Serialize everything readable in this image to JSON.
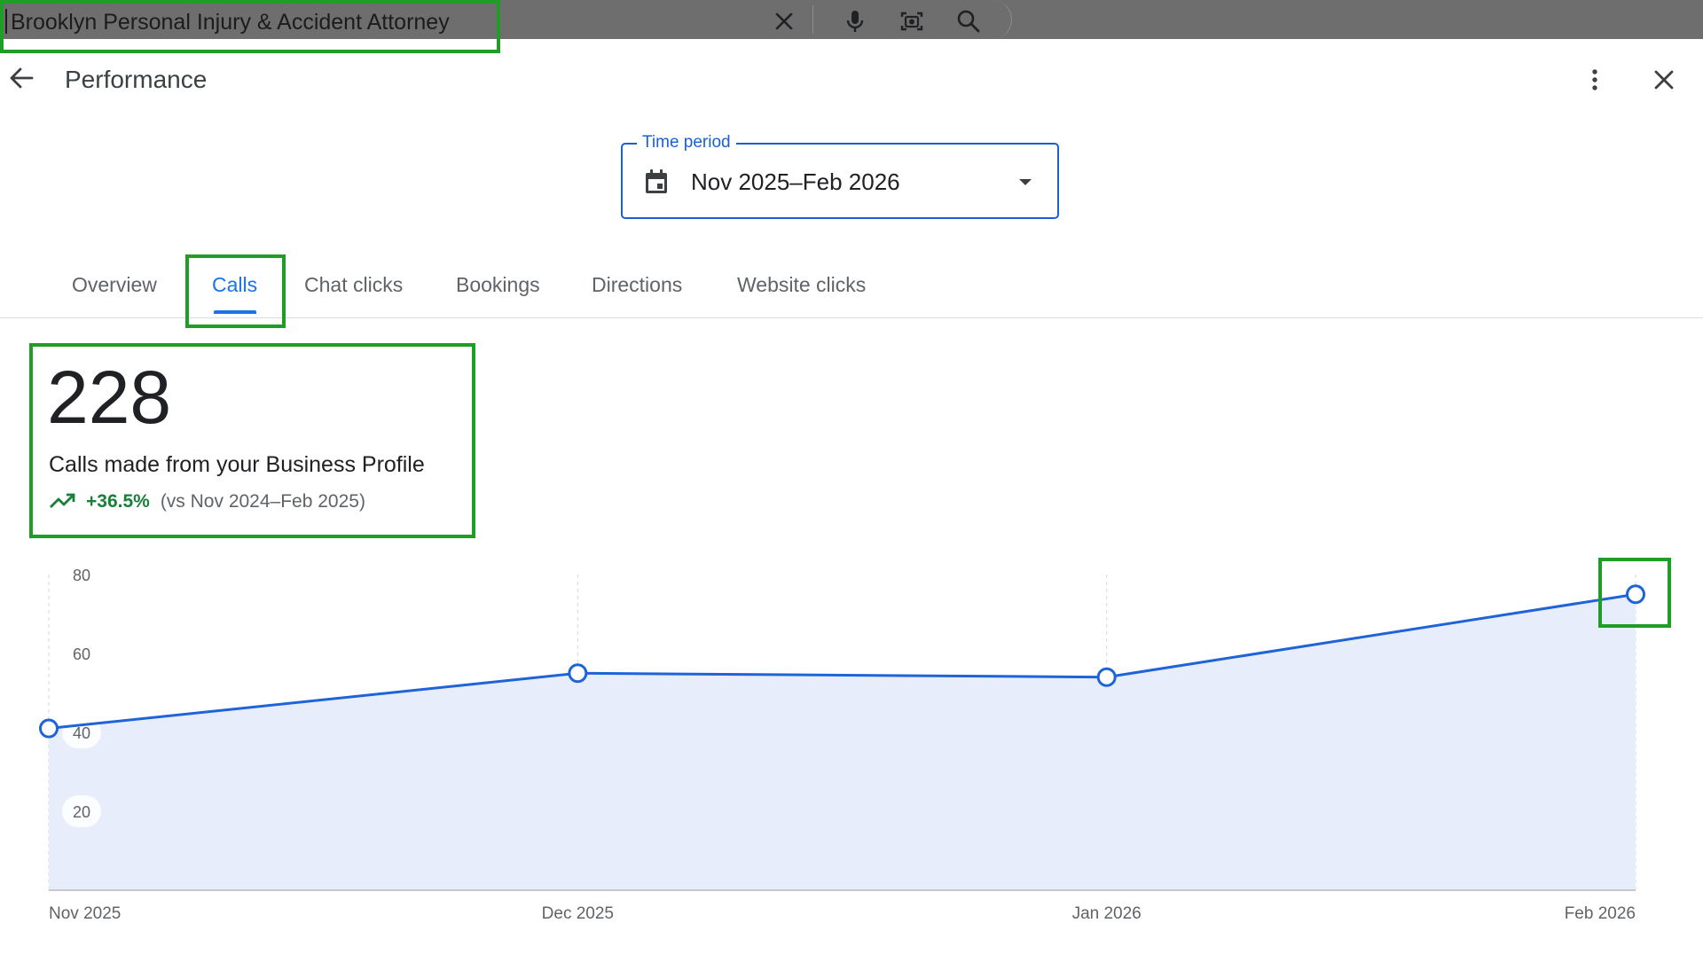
{
  "search": {
    "query": "Brooklyn Personal Injury & Accident Attorney",
    "icons": [
      "close-icon",
      "mic-icon",
      "camera-icon",
      "search-icon"
    ]
  },
  "header": {
    "title": "Performance",
    "icons": [
      "back-arrow-icon",
      "more-vert-icon",
      "close-icon"
    ]
  },
  "time_period": {
    "label": "Time period",
    "value": "Nov 2025–Feb 2026",
    "icon": "calendar-icon"
  },
  "tabs": [
    {
      "label": "Overview",
      "active": false
    },
    {
      "label": "Calls",
      "active": true
    },
    {
      "label": "Chat clicks",
      "active": false
    },
    {
      "label": "Bookings",
      "active": false
    },
    {
      "label": "Directions",
      "active": false
    },
    {
      "label": "Website clicks",
      "active": false
    }
  ],
  "summary": {
    "value": "228",
    "description": "Calls made from your Business Profile",
    "change": "+36.5%",
    "comparison": "(vs Nov 2024–Feb 2025)"
  },
  "colors": {
    "accent": "#1a73e8",
    "line": "#1e63d8",
    "area": "#e8edfb",
    "positive": "#188038",
    "highlight": "#1e9e26"
  },
  "chart_data": {
    "type": "area",
    "x": [
      "Nov 2025",
      "Dec 2025",
      "Jan 2026",
      "Feb 2026"
    ],
    "series": [
      {
        "values": [
          41,
          55,
          54,
          75
        ]
      }
    ],
    "yticks": [
      20,
      40,
      60,
      80
    ],
    "ylim": [
      0,
      80
    ],
    "grid": "vertical dashed"
  }
}
